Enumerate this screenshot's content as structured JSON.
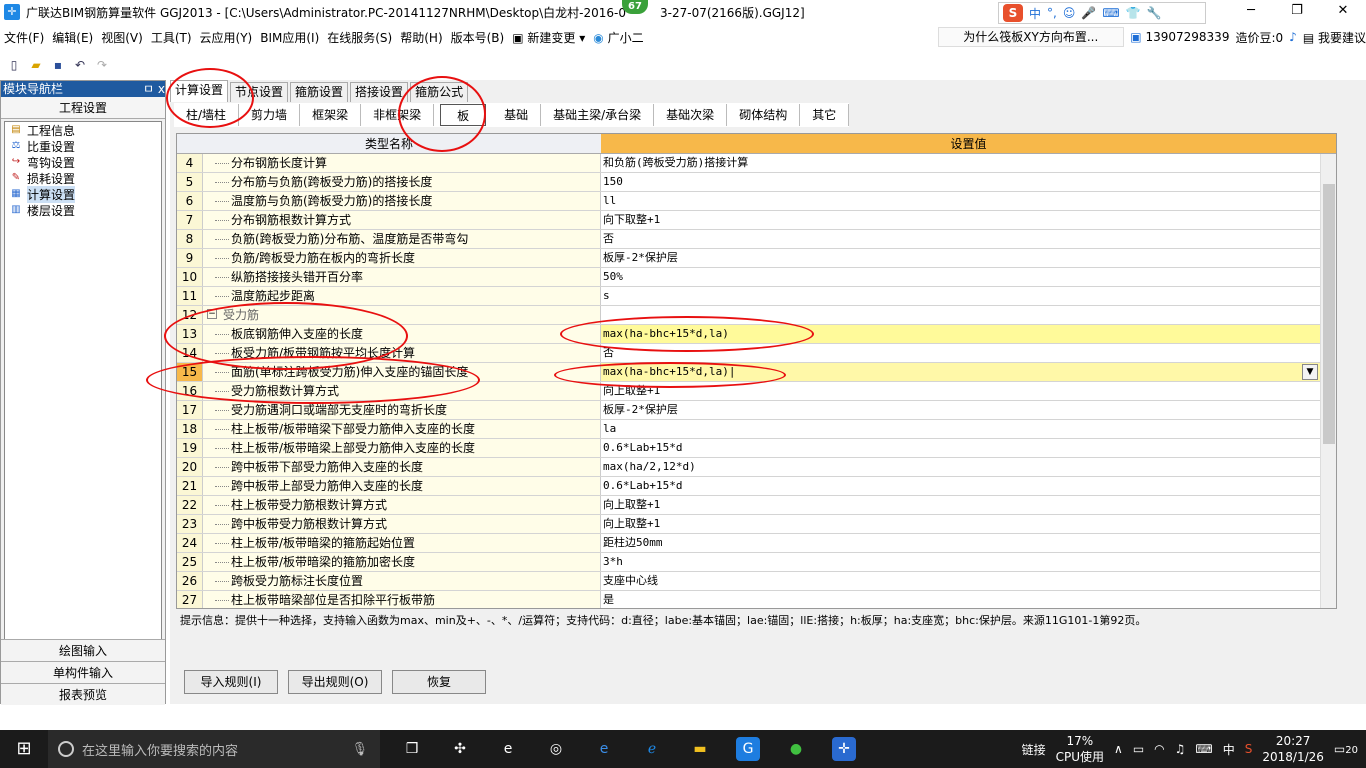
{
  "window": {
    "title": "广联达BIM钢筋算量软件 GGJ2013 - [C:\\Users\\Administrator.PC-20141127NRHM\\Desktop\\白龙村-2016-0",
    "title_tail": "3-27-07(2166版).GGJ12]",
    "badge": "67",
    "ime": [
      "中",
      "°,",
      "☺",
      "🎤",
      "⌨",
      "👕",
      "🔧"
    ],
    "ime_logo": "S"
  },
  "menu": {
    "items": [
      "文件(F)",
      "编辑(E)",
      "视图(V)",
      "工具(T)",
      "云应用(Y)",
      "BIM应用(I)",
      "在线服务(S)",
      "帮助(H)",
      "版本号(B)",
      "新建变更",
      "广小二"
    ],
    "tip": "为什么筏板XY方向布置...",
    "phone": "13907298339",
    "beans": "造价豆:0",
    "suggest": "我要建议"
  },
  "nav": {
    "header": "模块导航栏",
    "pin": "ㅁ x",
    "section": "工程设置",
    "items": [
      "工程信息",
      "比重设置",
      "弯钩设置",
      "损耗设置",
      "计算设置",
      "楼层设置"
    ],
    "bottom": [
      "绘图输入",
      "单构件输入",
      "报表预览"
    ]
  },
  "tabs": [
    "计算设置",
    "节点设置",
    "箍筋设置",
    "搭接设置",
    "箍筋公式"
  ],
  "subtabs": [
    "柱/墙柱",
    "剪力墙",
    "框架梁",
    "非框架梁",
    "板",
    "基础",
    "基础主梁/承台梁",
    "基础次梁",
    "砌体结构",
    "其它"
  ],
  "grid": {
    "col_type": "类型名称",
    "col_value": "设置值",
    "rows": [
      {
        "n": "4",
        "name": "分布钢筋长度计算",
        "value": "和负筋(跨板受力筋)搭接计算"
      },
      {
        "n": "5",
        "name": "分布筋与负筋(跨板受力筋)的搭接长度",
        "value": "150"
      },
      {
        "n": "6",
        "name": "温度筋与负筋(跨板受力筋)的搭接长度",
        "value": "ll"
      },
      {
        "n": "7",
        "name": "分布钢筋根数计算方式",
        "value": "向下取整+1"
      },
      {
        "n": "8",
        "name": "负筋(跨板受力筋)分布筋、温度筋是否带弯勾",
        "value": "否"
      },
      {
        "n": "9",
        "name": "负筋/跨板受力筋在板内的弯折长度",
        "value": "板厚-2*保护层"
      },
      {
        "n": "10",
        "name": "纵筋搭接接头错开百分率",
        "value": "50%"
      },
      {
        "n": "11",
        "name": "温度筋起步距离",
        "value": "s"
      },
      {
        "n": "12",
        "name": "受力筋",
        "value": ""
      },
      {
        "n": "13",
        "name": "板底钢筋伸入支座的长度",
        "value": "max(ha-bhc+15*d,la)"
      },
      {
        "n": "14",
        "name": "板受力筋/板带钢筋按平均长度计算",
        "value": "否"
      },
      {
        "n": "15",
        "name": "面筋(单标注跨板受力筋)伸入支座的锚固长度",
        "value": "max(ha-bhc+15*d,la)|"
      },
      {
        "n": "16",
        "name": "受力筋根数计算方式",
        "value": "向上取整+1"
      },
      {
        "n": "17",
        "name": "受力筋遇洞口或端部无支座时的弯折长度",
        "value": "板厚-2*保护层"
      },
      {
        "n": "18",
        "name": "柱上板带/板带暗梁下部受力筋伸入支座的长度",
        "value": "la"
      },
      {
        "n": "19",
        "name": "柱上板带/板带暗梁上部受力筋伸入支座的长度",
        "value": "0.6*Lab+15*d"
      },
      {
        "n": "20",
        "name": "跨中板带下部受力筋伸入支座的长度",
        "value": "max(ha/2,12*d)"
      },
      {
        "n": "21",
        "name": "跨中板带上部受力筋伸入支座的长度",
        "value": "0.6*Lab+15*d"
      },
      {
        "n": "22",
        "name": "柱上板带受力筋根数计算方式",
        "value": "向上取整+1"
      },
      {
        "n": "23",
        "name": "跨中板带受力筋根数计算方式",
        "value": "向上取整+1"
      },
      {
        "n": "24",
        "name": "柱上板带/板带暗梁的箍筋起始位置",
        "value": "距柱边50mm"
      },
      {
        "n": "25",
        "name": "柱上板带/板带暗梁的箍筋加密长度",
        "value": "3*h"
      },
      {
        "n": "26",
        "name": "跨板受力筋标注长度位置",
        "value": "支座中心线"
      },
      {
        "n": "27",
        "name": "柱上板带暗梁部位是否扣除平行板带筋",
        "value": "是"
      }
    ]
  },
  "hint": "提示信息：提供十一种选择，支持输入函数为max、min及+、-、*、/运算符；支持代码：d:直径；labe:基本锚固；lae:锚固；llE:搭接；h:板厚；ha:支座宽；bhc:保护层。来源11G101-1第92页。",
  "buttons": [
    "导入规则(I)",
    "导出规则(O)",
    "恢复"
  ],
  "taskbar": {
    "search": "在这里输入你要搜索的内容",
    "link": "链接",
    "cpu": "17%",
    "cpu_label": "CPU使用",
    "ime": "中",
    "time": "20:27",
    "date": "2018/1/26",
    "notif": "20"
  },
  "colors": {
    "accent": "#f7b84a",
    "annotation": "#e81010",
    "nav_header": "#1f5aa0"
  }
}
